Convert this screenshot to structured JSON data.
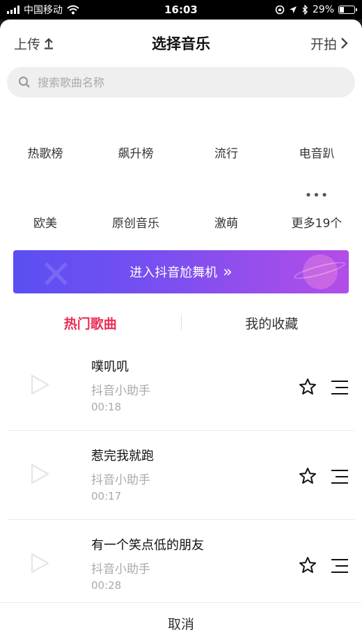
{
  "status_bar": {
    "carrier": "中国移动",
    "time": "16:03",
    "battery": "29%",
    "battery_level": 0.29
  },
  "header": {
    "upload_label": "上传",
    "title": "选择音乐",
    "start_label": "开拍"
  },
  "search": {
    "placeholder": "搜索歌曲名称"
  },
  "categories": {
    "row1": [
      "热歌榜",
      "飙升榜",
      "流行",
      "电音趴"
    ],
    "row2": [
      "欧美",
      "原创音乐",
      "激萌",
      "更多19个"
    ],
    "more_dots": "•••"
  },
  "banner": {
    "label": "进入抖音尬舞机",
    "arrow": "»"
  },
  "tabs": [
    "热门歌曲",
    "我的收藏"
  ],
  "songs": [
    {
      "title": "噗叽叽",
      "artist": "抖音小助手",
      "duration": "00:18"
    },
    {
      "title": "惹完我就跑",
      "artist": "抖音小助手",
      "duration": "00:17"
    },
    {
      "title": "有一个笑点低的朋友",
      "artist": "抖音小助手",
      "duration": "00:28"
    }
  ],
  "footer": {
    "cancel_label": "取消"
  },
  "colors": {
    "accent": "#ea2d57",
    "banner_start": "#5a4ff2",
    "banner_end": "#b44de8"
  }
}
